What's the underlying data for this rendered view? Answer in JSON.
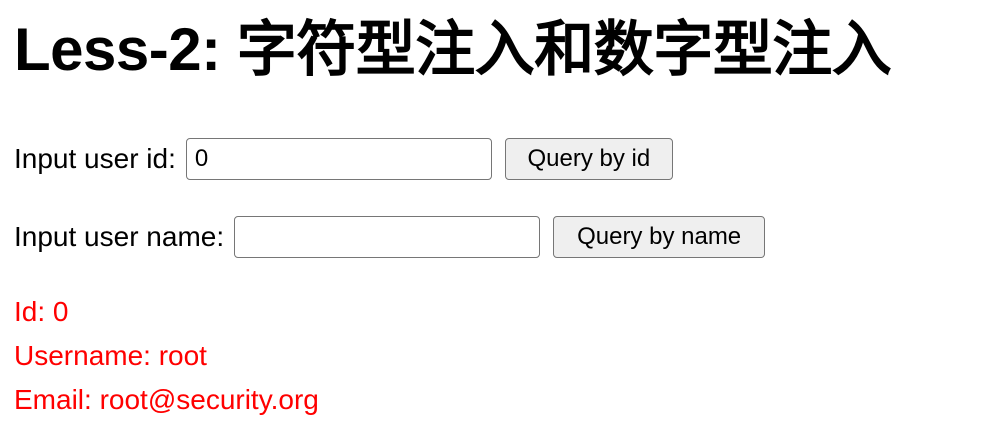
{
  "page": {
    "title": "Less-2: 字符型注入和数字型注入"
  },
  "form_id": {
    "label": "Input user id:",
    "value": "0",
    "button_label": "Query by id"
  },
  "form_name": {
    "label": "Input user name:",
    "value": "",
    "button_label": "Query by name"
  },
  "result": {
    "id_line": "Id: 0",
    "username_line": "Username: root",
    "email_line": "Email: root@security.org"
  },
  "colors": {
    "result_text": "#ff0000",
    "button_bg": "#efefef",
    "input_border": "#767676"
  }
}
